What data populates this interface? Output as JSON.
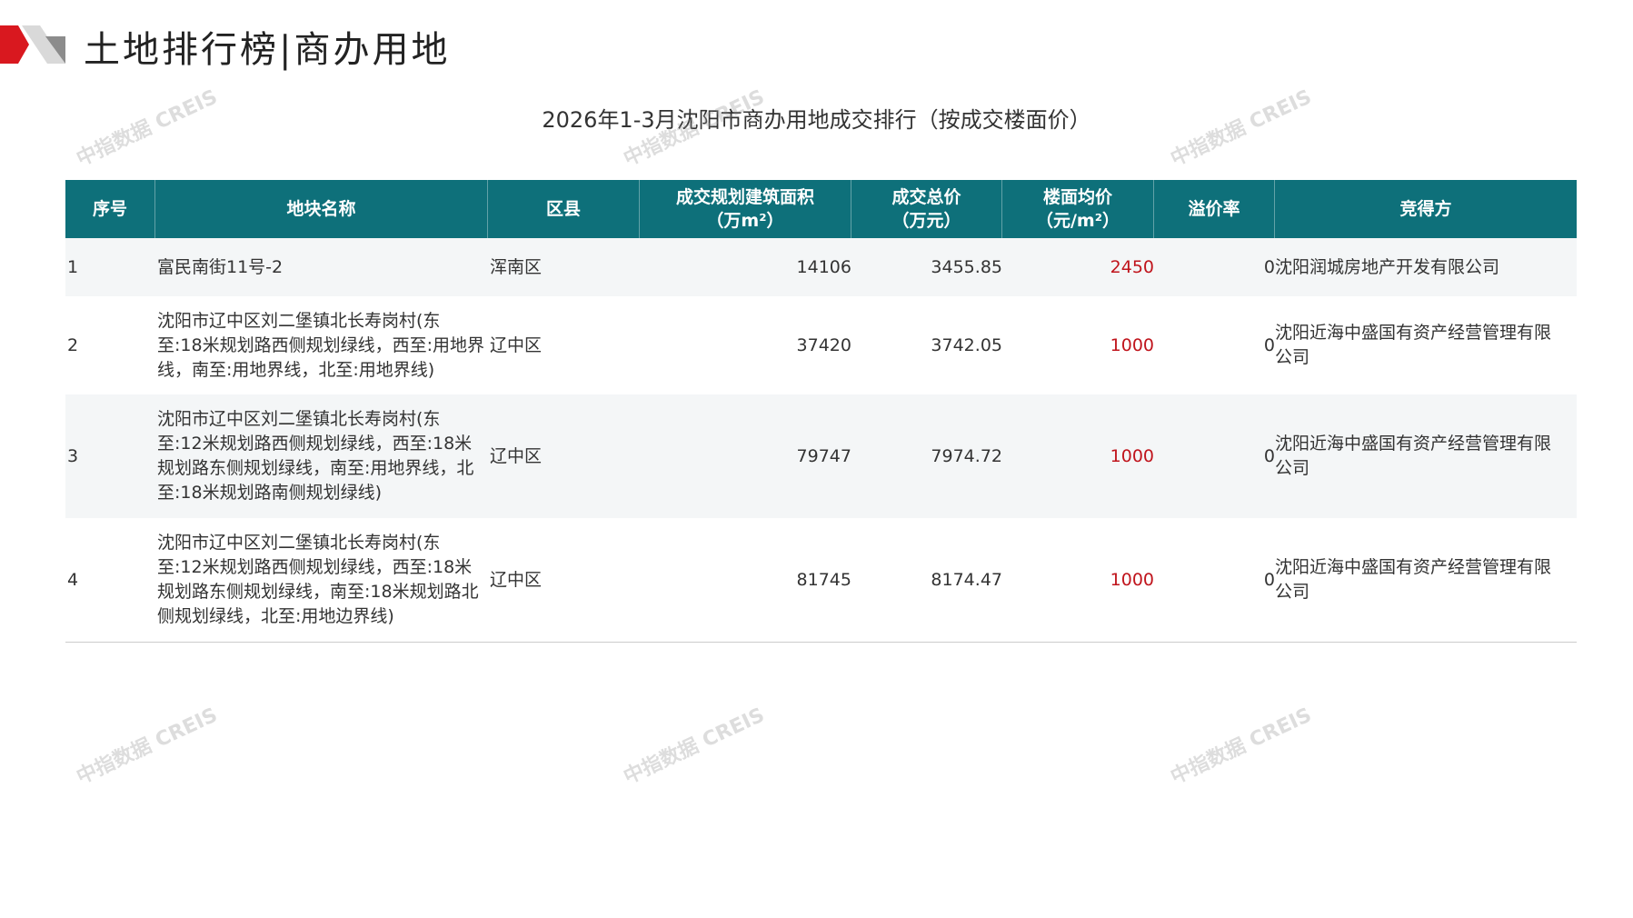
{
  "header": {
    "title": "土地排行榜|商办用地",
    "logo_colors": {
      "red": "#d9181f",
      "gray": "#8c8c8c",
      "light": "#d9d9d9"
    }
  },
  "table": {
    "caption": "2026年1-3月沈阳市商办用地成交排行（按成交楼面价）",
    "header_color": "#0e707a",
    "highlight_color": "#c0141c",
    "columns": [
      {
        "label": "序号",
        "unit": ""
      },
      {
        "label": "地块名称",
        "unit": ""
      },
      {
        "label": "区县",
        "unit": ""
      },
      {
        "label": "成交规划建筑面积",
        "unit": "（万m²）"
      },
      {
        "label": "成交总价",
        "unit": "（万元）"
      },
      {
        "label": "楼面均价",
        "unit": "（元/m²）"
      },
      {
        "label": "溢价率",
        "unit": ""
      },
      {
        "label": "竞得方",
        "unit": ""
      }
    ],
    "rows": [
      {
        "rank": "1",
        "name": "富民南街11号-2",
        "district": "浑南区",
        "area": "14106",
        "total_price": "3455.85",
        "unit_price": "2450",
        "premium": "0",
        "bidder": "沈阳润城房地产开发有限公司"
      },
      {
        "rank": "2",
        "name": "沈阳市辽中区刘二堡镇北长寿岗村(东至:18米规划路西侧规划绿线，西至:用地界线，南至:用地界线，北至:用地界线)",
        "district": "辽中区",
        "area": "37420",
        "total_price": "3742.05",
        "unit_price": "1000",
        "premium": "0",
        "bidder": "沈阳近海中盛国有资产经营管理有限公司"
      },
      {
        "rank": "3",
        "name": "沈阳市辽中区刘二堡镇北长寿岗村(东至:12米规划路西侧规划绿线，西至:18米规划路东侧规划绿线，南至:用地界线，北至:18米规划路南侧规划绿线)",
        "district": "辽中区",
        "area": "79747",
        "total_price": "7974.72",
        "unit_price": "1000",
        "premium": "0",
        "bidder": "沈阳近海中盛国有资产经营管理有限公司"
      },
      {
        "rank": "4",
        "name": "沈阳市辽中区刘二堡镇北长寿岗村(东至:12米规划路西侧规划绿线，西至:18米规划路东侧规划绿线，南至:18米规划路北侧规划绿线，北至:用地边界线)",
        "district": "辽中区",
        "area": "81745",
        "total_price": "8174.47",
        "unit_price": "1000",
        "premium": "0",
        "bidder": "沈阳近海中盛国有资产经营管理有限公司"
      }
    ]
  },
  "watermark": {
    "text": "中指数据 CREIS"
  }
}
